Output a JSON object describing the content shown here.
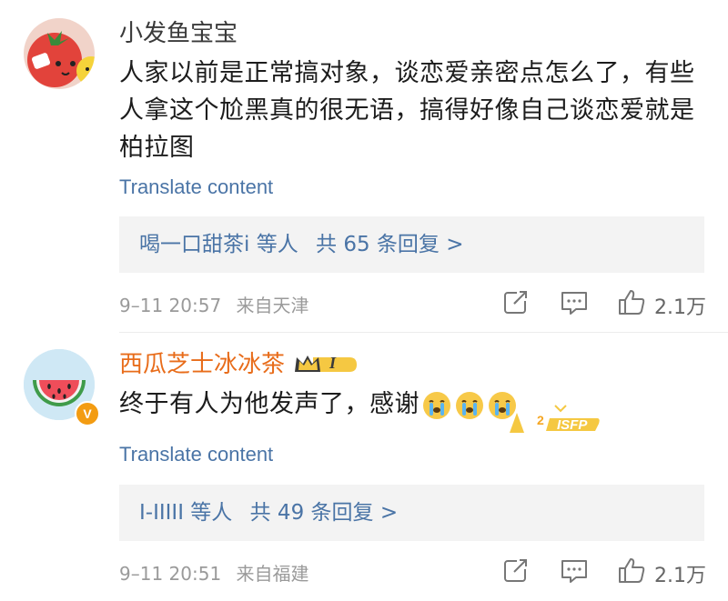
{
  "comments": [
    {
      "username": "小发鱼宝宝",
      "text": "人家以前是正常搞对象，谈恋爱亲密点怎么了，有些人拿这个尬黑真的很无语，搞得好像自己谈恋爱就是柏拉图",
      "translate_label": "Translate content",
      "replies_users": "喝一口甜茶i 等人",
      "replies_count": "共 65 条回复 >",
      "time": "9–11 20:57",
      "location": "来自天津",
      "likes": "2.1万",
      "avatar_icon": "tomato-character-avatar"
    },
    {
      "username": "西瓜芝士冰冰茶",
      "text": "终于有人为他发声了，感谢",
      "badge_text": "I",
      "sticker_text": "ISFP",
      "sticker_number": "2",
      "translate_label": "Translate content",
      "replies_users": "I-IIIII 等人",
      "replies_count": "共 49 条回复 >",
      "time": "9–11 20:51",
      "location": "来自福建",
      "likes": "2.1万",
      "avatar_icon": "watermelon-avatar",
      "verified_mark": "V"
    }
  ],
  "colors": {
    "link": "#4a74a6",
    "username_default": "#3a3a3a",
    "username_vip": "#e86c1a",
    "meta": "#9a9a9a",
    "reply_bg": "#f3f3f3"
  }
}
